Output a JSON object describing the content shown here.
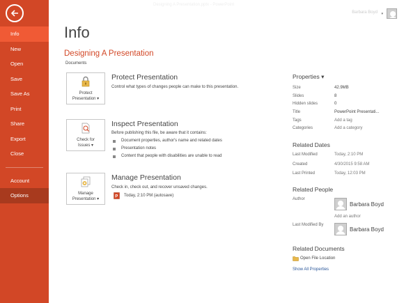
{
  "window": {
    "document_title": "Designing A Presentation.pptx - PowerPoint",
    "user_name": "Barbara Boyd"
  },
  "sidebar": {
    "items": [
      {
        "label": "Info"
      },
      {
        "label": "New"
      },
      {
        "label": "Open"
      },
      {
        "label": "Save"
      },
      {
        "label": "Save As"
      },
      {
        "label": "Print"
      },
      {
        "label": "Share"
      },
      {
        "label": "Export"
      },
      {
        "label": "Close"
      },
      {
        "label": "Account"
      },
      {
        "label": "Options"
      }
    ],
    "colors": {
      "bg": "#d24726",
      "active": "#f05a35",
      "hover": "#a83a1e"
    }
  },
  "main": {
    "page_title": "Info",
    "doc_title": "Designing A Presentation",
    "doc_path": "Documents",
    "sections": {
      "protect": {
        "button_line1": "Protect",
        "button_line2": "Presentation ▾",
        "title": "Protect Presentation",
        "desc": "Control what types of changes people can make to this presentation."
      },
      "inspect": {
        "button_line1": "Check for",
        "button_line2": "Issues ▾",
        "title": "Inspect Presentation",
        "desc": "Before publishing this file, be aware that it contains:",
        "bullets": [
          "Document properties, author's name and related dates",
          "Presentation notes",
          "Content that people with disabilities are unable to read"
        ]
      },
      "manage": {
        "button_line1": "Manage",
        "button_line2": "Presentation ▾",
        "title": "Manage Presentation",
        "desc": "Check in, check out, and recover unsaved changes.",
        "version": "Today, 2:10 PM (autosave)"
      }
    }
  },
  "properties": {
    "header": "Properties ▾",
    "rows": [
      {
        "label": "Size",
        "value": "42.9MB"
      },
      {
        "label": "Slides",
        "value": "8"
      },
      {
        "label": "Hidden slides",
        "value": "0"
      },
      {
        "label": "Title",
        "value": "PowerPoint Presentati..."
      },
      {
        "label": "Tags",
        "value": "Add a tag"
      },
      {
        "label": "Categories",
        "value": "Add a category"
      }
    ],
    "related_dates": {
      "header": "Related Dates",
      "rows": [
        {
          "label": "Last Modified",
          "value": "Today, 2:10 PM"
        },
        {
          "label": "Created",
          "value": "4/30/2015 9:58 AM"
        },
        {
          "label": "Last Printed",
          "value": "Today, 12:03 PM"
        }
      ]
    },
    "related_people": {
      "header": "Related People",
      "author_label": "Author",
      "author_name": "Barbara Boyd",
      "add_author": "Add an author",
      "modified_by_label": "Last Modified By",
      "modified_by_name": "Barbara Boyd"
    },
    "related_documents": {
      "header": "Related Documents",
      "open_location": "Open File Location",
      "show_all": "Show All Properties"
    }
  }
}
